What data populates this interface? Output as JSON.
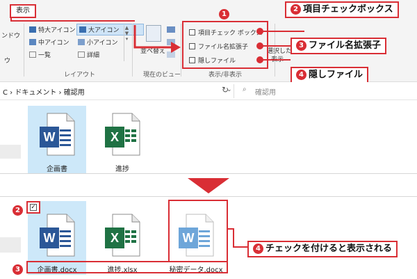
{
  "ribbon": {
    "view_tab": "表示",
    "nav_pane_fragment": "ンドウ",
    "nav_pane_fragment2": "ウ",
    "layout_items": [
      {
        "label": "特大アイコン",
        "icon": "large-icons-icon"
      },
      {
        "label": "大アイコン",
        "icon": "large-icons-icon"
      },
      {
        "label": "中アイコン",
        "icon": "medium-icons-icon"
      },
      {
        "label": "小アイコン",
        "icon": "small-icons-icon"
      },
      {
        "label": "一覧",
        "icon": "list-icon"
      },
      {
        "label": "詳細",
        "icon": "details-icon"
      }
    ],
    "layout_group_label": "レイアウト",
    "sort_label": "並べ替え",
    "current_view_label": "現在のビュー",
    "show_hide_items": [
      "項目チェック ボックス",
      "ファイル名拡張子",
      "隠しファイル"
    ],
    "show_hide_group_label": "表示/非表示",
    "fragment_right": "選択した",
    "fragment_right2": "表示"
  },
  "address_bar": {
    "breadcrumb_prefix": "C",
    "breadcrumb": [
      "ドキュメント",
      "確認用"
    ],
    "search_placeholder": "確認用"
  },
  "top_files": [
    {
      "name": "企画書",
      "type": "word",
      "selected": true
    },
    {
      "name": "進捗",
      "type": "excel",
      "selected": false
    }
  ],
  "bottom_files": [
    {
      "name": "企画書.docx",
      "type": "word",
      "selected": true
    },
    {
      "name": "進捗.xlsx",
      "type": "excel",
      "selected": false
    },
    {
      "name": "秘密データ.docx",
      "type": "word-hidden",
      "selected": false
    }
  ],
  "callouts": {
    "one": "1",
    "two_num": "2",
    "two": "項目チェックボックス",
    "three_num": "3",
    "three": "ファイル名拡張子",
    "four_num": "4",
    "four": "隠しファイル",
    "bottom_two": "2",
    "bottom_three": "3",
    "bottom_four_num": "4",
    "bottom_four": "チェックを付けると表示される"
  },
  "icon_letters": {
    "word": "W",
    "excel": "X"
  },
  "colors": {
    "accent_red": "#d92e35",
    "word_blue": "#2b5797",
    "excel_green": "#1f7244",
    "selection_blue": "#cde8f9",
    "hidden_blue": "#6ea6d9"
  }
}
